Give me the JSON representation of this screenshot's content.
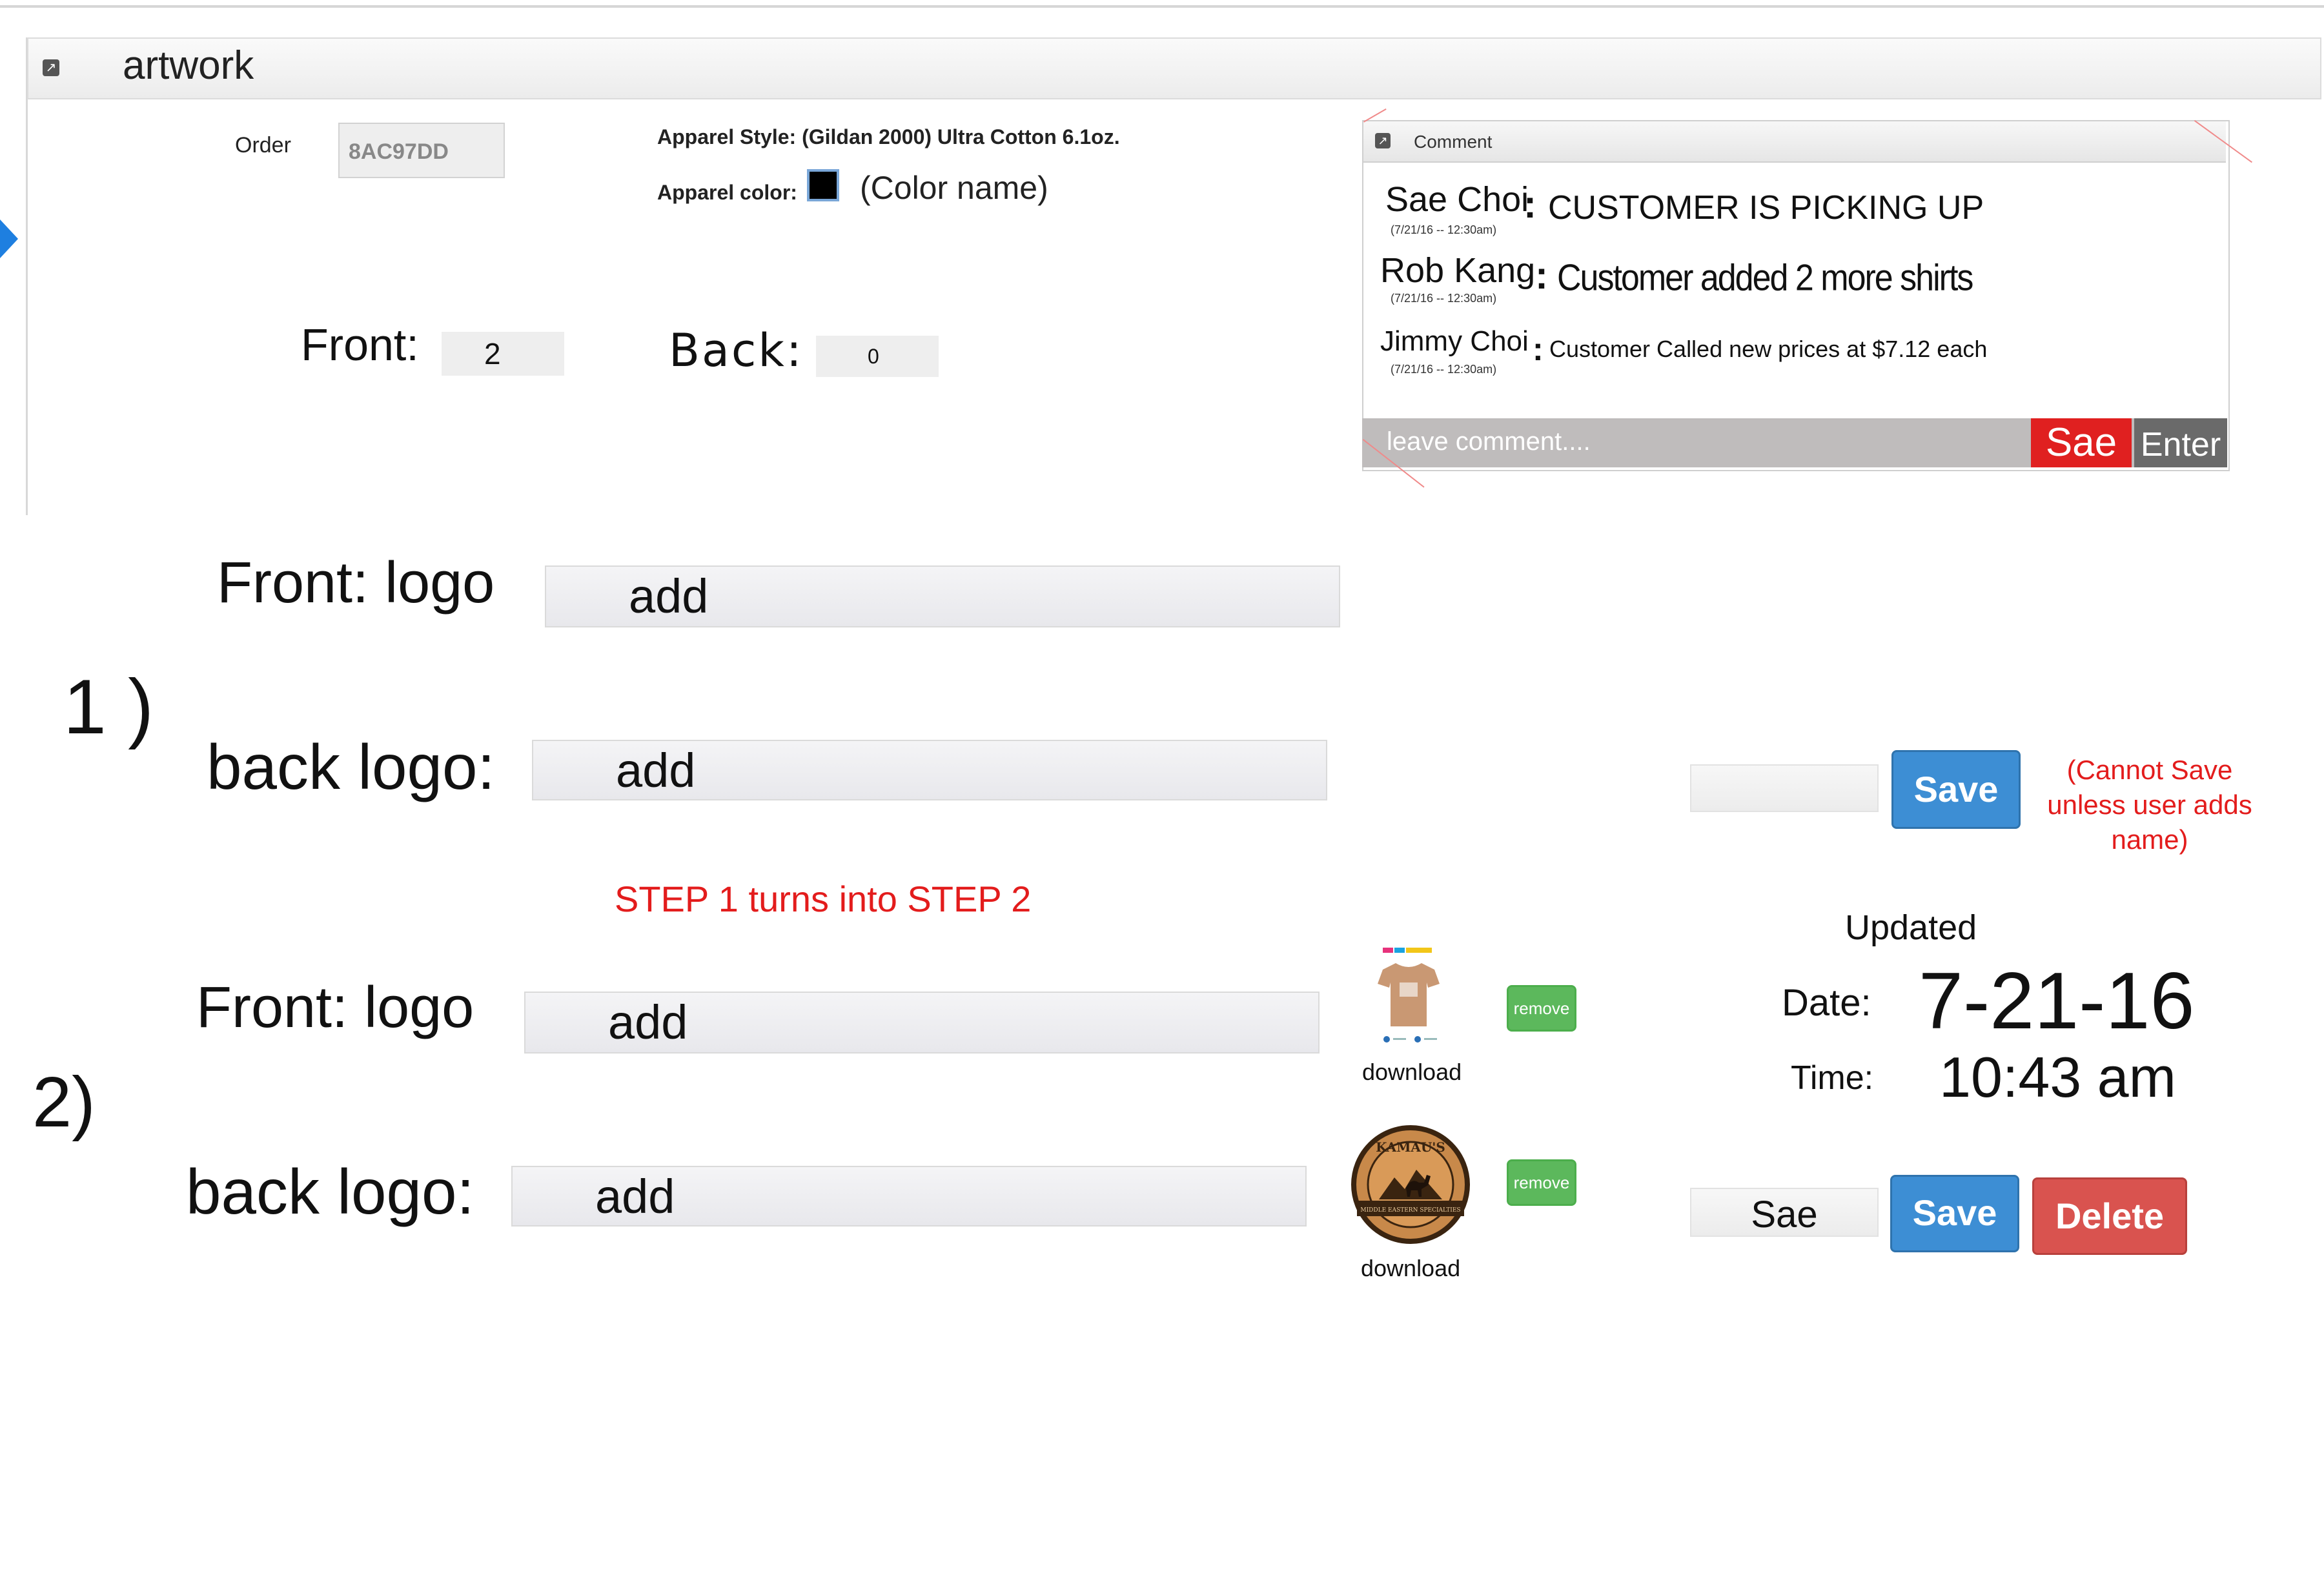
{
  "panel": {
    "title": "artwork"
  },
  "order": {
    "label": "Order",
    "value": "8AC97DD"
  },
  "apparel": {
    "style": "Apparel Style: (Gildan 2000) Ultra Cotton 6.1oz.",
    "color_label": "Apparel color:",
    "color_name": "(Color name)",
    "swatch_color": "#000000"
  },
  "counts": {
    "front_label": "Front:",
    "front_value": "2",
    "back_label": "Back:",
    "back_value": "0"
  },
  "comments": {
    "title": "Comment",
    "items": [
      {
        "name": "Sae Choi",
        "time": "(7/21/16 -- 12:30am)",
        "text": "CUSTOMER IS PICKING UP"
      },
      {
        "name": "Rob Kang",
        "time": "(7/21/16 -- 12:30am)",
        "text": "Customer  added 2 more shirts"
      },
      {
        "name": "Jimmy Choi",
        "time": "(7/21/16 -- 12:30am)",
        "text": "Customer Called new prices at $7.12 each"
      }
    ],
    "colon": ":",
    "placeholder": "leave comment....",
    "sae_label": "Sae",
    "enter_label": "Enter"
  },
  "step1": {
    "number": "1 )",
    "front_label": "Front: logo",
    "front_add": "add",
    "back_label": "back logo:",
    "back_add": "add",
    "save_label": "Save",
    "note": "(Cannot Save unless user adds name)"
  },
  "transition": "STEP 1 turns into STEP 2",
  "step2": {
    "number": "2)",
    "front_label": "Front: logo",
    "front_add": "add",
    "back_label": "back logo:",
    "back_add": "add",
    "remove_label": "remove",
    "download_label": "download",
    "logo_text_top": "KAMAU'S",
    "logo_text_band": "MIDDLE EASTERN SPECIALTIES",
    "name_value": "Sae",
    "save_label": "Save",
    "delete_label": "Delete"
  },
  "updated": {
    "title": "Updated",
    "date_label": "Date:",
    "date_value": "7-21-16",
    "time_label": "Time:",
    "time_value": "10:43 am"
  },
  "colors": {
    "accent_blue": "#3d8ed4",
    "danger_red": "#d9534f",
    "success_green": "#5cb85c",
    "alert_red": "#e31c1c"
  }
}
